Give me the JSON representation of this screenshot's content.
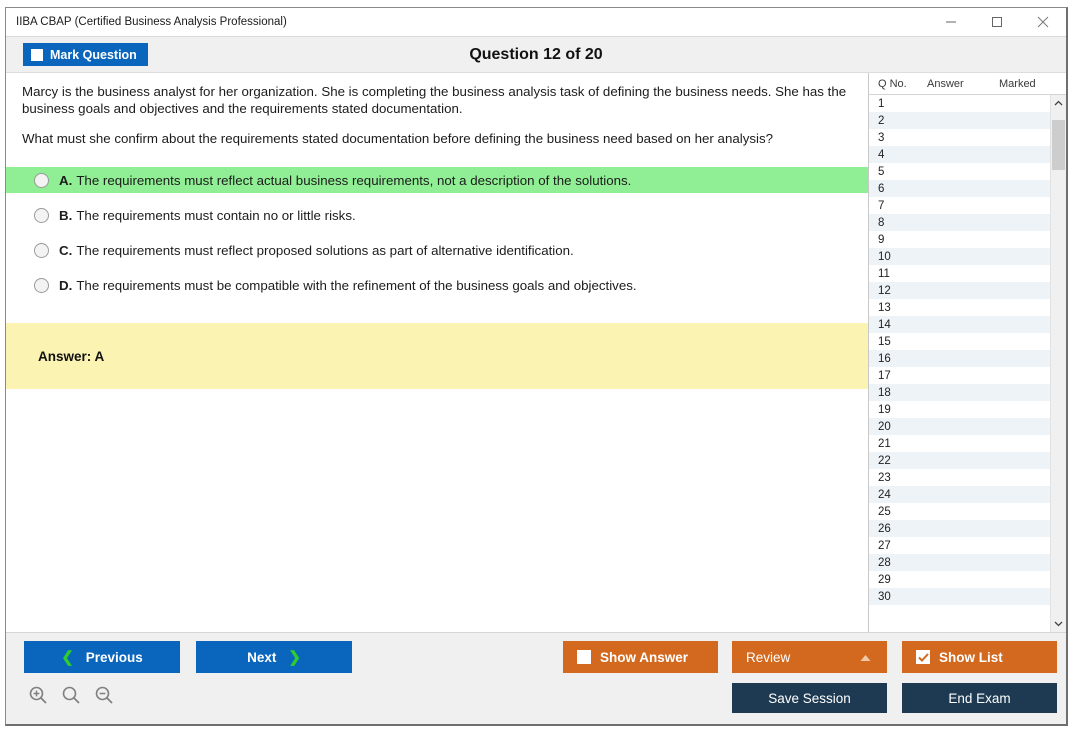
{
  "window": {
    "title": "IIBA CBAP (Certified Business Analysis Professional)",
    "minimize_label": "—",
    "maximize_label": "□",
    "close_label": "✕"
  },
  "header": {
    "mark_question_label": "Mark Question",
    "mark_question_checked": false,
    "question_title": "Question 12 of 20"
  },
  "question": {
    "paragraph1": "Marcy is the business analyst for her organization. She is completing the business analysis task of defining the business needs. She has the business goals and objectives and the requirements stated documentation.",
    "paragraph2": "What must she confirm about the requirements stated documentation before defining the business need based on her analysis?",
    "options": [
      {
        "letter": "A.",
        "text": "The requirements must reflect actual business requirements, not a description of the solutions.",
        "correct": true,
        "selected": false
      },
      {
        "letter": "B.",
        "text": "The requirements must contain no or little risks.",
        "correct": false,
        "selected": false
      },
      {
        "letter": "C.",
        "text": "The requirements must reflect proposed solutions as part of alternative identification.",
        "correct": false,
        "selected": false
      },
      {
        "letter": "D.",
        "text": "The requirements must be compatible with the refinement of the business goals and objectives.",
        "correct": false,
        "selected": false
      }
    ],
    "answer_label": "Answer: A"
  },
  "question_list": {
    "columns": [
      "Q No.",
      "Answer",
      "Marked"
    ],
    "rows": [
      {
        "qno": "1",
        "answer": "",
        "marked": ""
      },
      {
        "qno": "2",
        "answer": "",
        "marked": ""
      },
      {
        "qno": "3",
        "answer": "",
        "marked": ""
      },
      {
        "qno": "4",
        "answer": "",
        "marked": ""
      },
      {
        "qno": "5",
        "answer": "",
        "marked": ""
      },
      {
        "qno": "6",
        "answer": "",
        "marked": ""
      },
      {
        "qno": "7",
        "answer": "",
        "marked": ""
      },
      {
        "qno": "8",
        "answer": "",
        "marked": ""
      },
      {
        "qno": "9",
        "answer": "",
        "marked": ""
      },
      {
        "qno": "10",
        "answer": "",
        "marked": ""
      },
      {
        "qno": "11",
        "answer": "",
        "marked": ""
      },
      {
        "qno": "12",
        "answer": "",
        "marked": ""
      },
      {
        "qno": "13",
        "answer": "",
        "marked": ""
      },
      {
        "qno": "14",
        "answer": "",
        "marked": ""
      },
      {
        "qno": "15",
        "answer": "",
        "marked": ""
      },
      {
        "qno": "16",
        "answer": "",
        "marked": ""
      },
      {
        "qno": "17",
        "answer": "",
        "marked": ""
      },
      {
        "qno": "18",
        "answer": "",
        "marked": ""
      },
      {
        "qno": "19",
        "answer": "",
        "marked": ""
      },
      {
        "qno": "20",
        "answer": "",
        "marked": ""
      },
      {
        "qno": "21",
        "answer": "",
        "marked": ""
      },
      {
        "qno": "22",
        "answer": "",
        "marked": ""
      },
      {
        "qno": "23",
        "answer": "",
        "marked": ""
      },
      {
        "qno": "24",
        "answer": "",
        "marked": ""
      },
      {
        "qno": "25",
        "answer": "",
        "marked": ""
      },
      {
        "qno": "26",
        "answer": "",
        "marked": ""
      },
      {
        "qno": "27",
        "answer": "",
        "marked": ""
      },
      {
        "qno": "28",
        "answer": "",
        "marked": ""
      },
      {
        "qno": "29",
        "answer": "",
        "marked": ""
      },
      {
        "qno": "30",
        "answer": "",
        "marked": ""
      }
    ]
  },
  "footer": {
    "previous_label": "Previous",
    "next_label": "Next",
    "show_answer_label": "Show Answer",
    "show_answer_checked": false,
    "review_label": "Review",
    "show_list_label": "Show List",
    "show_list_checked": true,
    "save_session_label": "Save Session",
    "end_exam_label": "End Exam"
  },
  "colors": {
    "primary_blue": "#0a65bd",
    "orange": "#d2691e",
    "navy": "#1d3a52",
    "correct_green": "#90ee94",
    "answer_yellow": "#fbf3b2",
    "chevron_green": "#2ecc2e"
  }
}
